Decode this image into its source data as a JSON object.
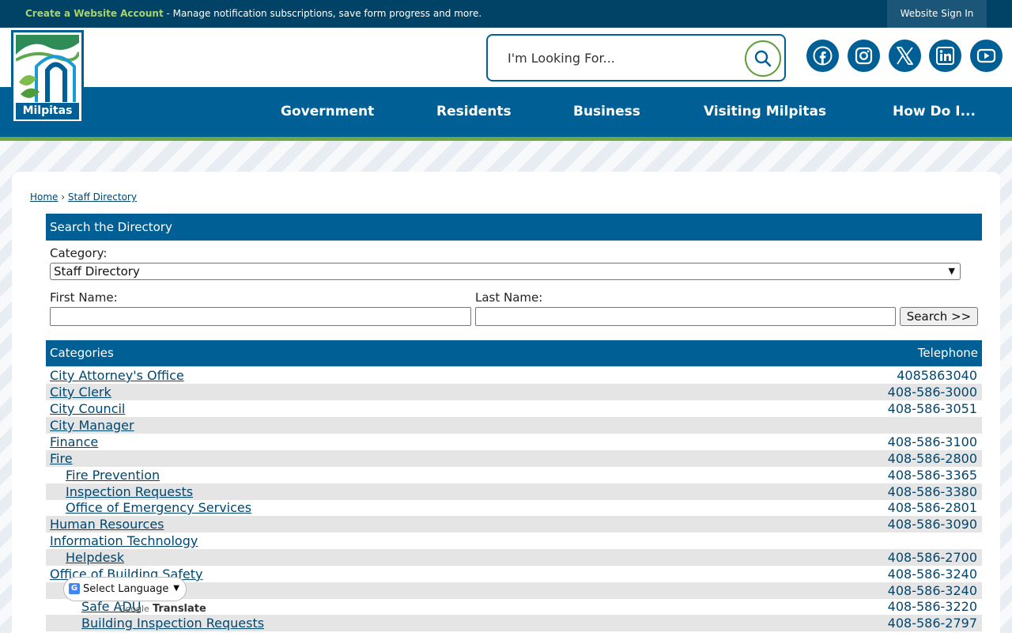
{
  "topbar": {
    "create_account": "Create a Website Account",
    "message": " - Manage notification subscriptions, save form progress and more.",
    "sign_in": "Website Sign In"
  },
  "logo": {
    "text": "Milpitas"
  },
  "search": {
    "placeholder": "I'm Looking For..."
  },
  "social": [
    "facebook-icon",
    "instagram-icon",
    "x-twitter-icon",
    "linkedin-icon",
    "youtube-icon"
  ],
  "nav": [
    "Government",
    "Residents",
    "Business",
    "Visiting Milpitas",
    "How Do I..."
  ],
  "breadcrumb": {
    "home": "Home",
    "separator": "›",
    "current": "Staff Directory"
  },
  "directory_search": {
    "heading": "Search the Directory",
    "category_label": "Category:",
    "category_value": "Staff Directory",
    "first_name_label": "First Name:",
    "last_name_label": "Last Name:",
    "submit": "Search >>"
  },
  "table": {
    "col_categories": "Categories",
    "col_telephone": "Telephone",
    "rows": [
      {
        "name": "City Attorney's Office",
        "phone": "4085863040",
        "level": 0
      },
      {
        "name": "City Clerk",
        "phone": "408-586-3000",
        "level": 0
      },
      {
        "name": "City Council",
        "phone": "408-586-3051",
        "level": 0
      },
      {
        "name": "City Manager",
        "phone": "",
        "level": 0
      },
      {
        "name": "Finance",
        "phone": "408-586-3100",
        "level": 0
      },
      {
        "name": "Fire",
        "phone": "408-586-2800",
        "level": 0
      },
      {
        "name": "Fire Prevention",
        "phone": "408-586-3365",
        "level": 1
      },
      {
        "name": "Inspection Requests",
        "phone": "408-586-3380",
        "level": 1
      },
      {
        "name": "Office of Emergency Services",
        "phone": "408-586-2801",
        "level": 1
      },
      {
        "name": "Human Resources",
        "phone": "408-586-3090",
        "level": 0
      },
      {
        "name": "Information Technology",
        "phone": "",
        "level": 0
      },
      {
        "name": "Helpdesk",
        "phone": "408-586-2700",
        "level": 1
      },
      {
        "name": "Office of Building Safety",
        "phone": "408-586-3240",
        "level": 0
      },
      {
        "name": "",
        "phone": "408-586-3240",
        "level": 1
      },
      {
        "name": "Safe ADU",
        "phone": "408-586-3220",
        "level": 2
      },
      {
        "name": "Building Inspection Requests",
        "phone": "408-586-2797",
        "level": 2
      }
    ]
  },
  "translate": {
    "select_label": "Select Language",
    "powered_google": "Google",
    "powered_translate": "Translate"
  },
  "colors": {
    "primary": "#005f94",
    "dark": "#004366",
    "green": "#6fa743",
    "link": "#00466f",
    "row_alt": "#e5e5e5"
  }
}
